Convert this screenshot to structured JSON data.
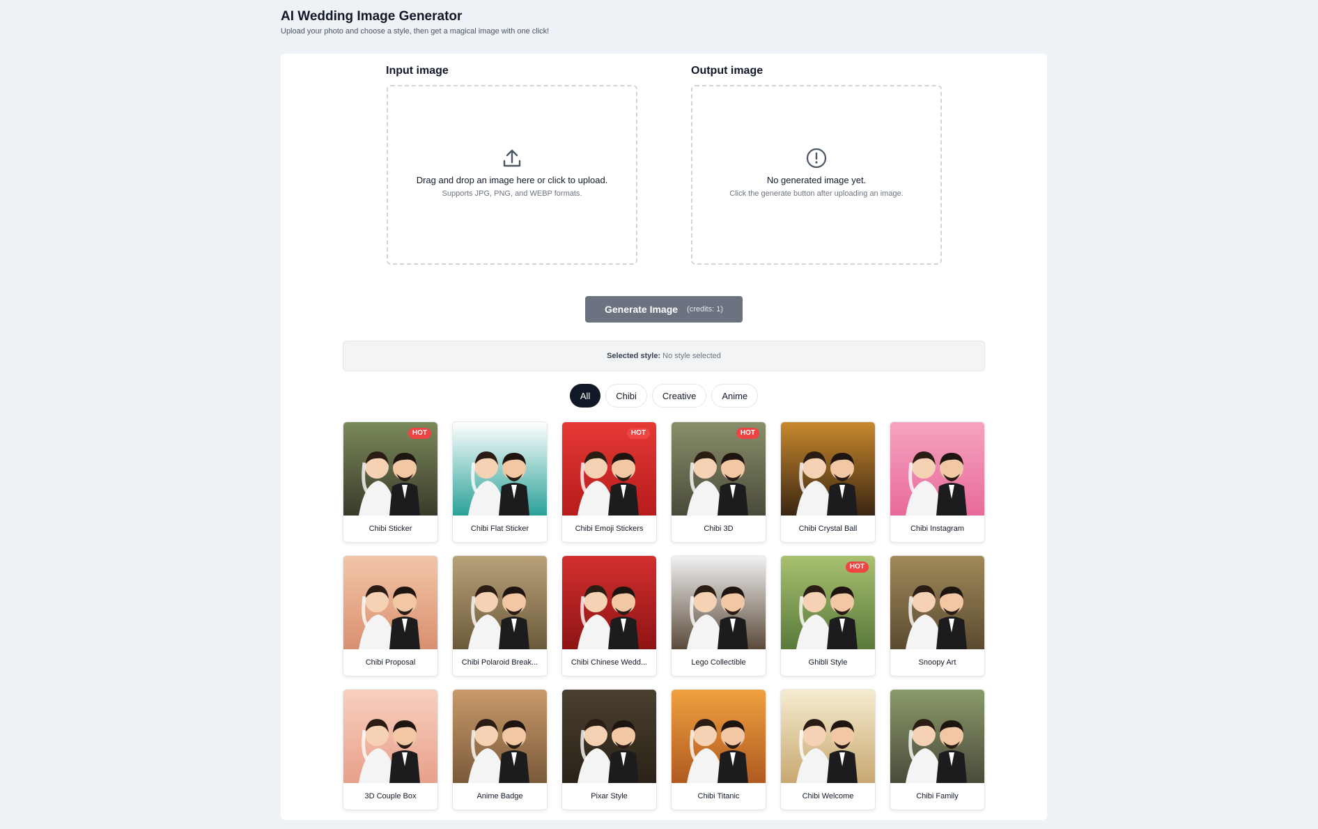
{
  "header": {
    "title": "AI Wedding Image Generator",
    "subtitle": "Upload your photo and choose a style, then get a magical image with one click!"
  },
  "input": {
    "label": "Input image",
    "main_text": "Drag and drop an image here or click to upload.",
    "sub_text": "Supports JPG, PNG, and WEBP formats.",
    "icon": "upload-icon"
  },
  "output": {
    "label": "Output image",
    "main_text": "No generated image yet.",
    "sub_text": "Click the generate button after uploading an image.",
    "icon": "alert-circle-icon"
  },
  "generate": {
    "label": "Generate Image",
    "credits": "(credits: 1)"
  },
  "selected_style": {
    "label": "Selected style:",
    "value": "No style selected"
  },
  "filters": [
    {
      "label": "All",
      "active": true
    },
    {
      "label": "Chibi",
      "active": false
    },
    {
      "label": "Creative",
      "active": false
    },
    {
      "label": "Anime",
      "active": false
    }
  ],
  "hot_badge": "HOT",
  "colors": {
    "accent_dark": "#111827",
    "hot": "#ef4444",
    "button_disabled": "#6b7280",
    "page_bg": "#eef1f5"
  },
  "styles": [
    {
      "name": "Chibi Sticker",
      "hot": true,
      "bg1": "#7a8a5a",
      "bg2": "#3a3a2a"
    },
    {
      "name": "Chibi Flat Sticker",
      "hot": false,
      "bg1": "#ffffff",
      "bg2": "#2aa198"
    },
    {
      "name": "Chibi Emoji Stickers",
      "hot": true,
      "bg1": "#e53935",
      "bg2": "#b71c1c"
    },
    {
      "name": "Chibi 3D",
      "hot": true,
      "bg1": "#8a8f6a",
      "bg2": "#4a4a3a"
    },
    {
      "name": "Chibi Crystal Ball",
      "hot": false,
      "bg1": "#c8892d",
      "bg2": "#3b2612"
    },
    {
      "name": "Chibi Instagram",
      "hot": false,
      "bg1": "#f5a3c0",
      "bg2": "#e86a9a"
    },
    {
      "name": "Chibi Proposal",
      "hot": false,
      "bg1": "#f2c6a8",
      "bg2": "#d99070"
    },
    {
      "name": "Chibi Polaroid Break...",
      "hot": false,
      "bg1": "#b9a27a",
      "bg2": "#6b5a3a"
    },
    {
      "name": "Chibi Chinese Wedd...",
      "hot": false,
      "bg1": "#d32f2f",
      "bg2": "#8e1414"
    },
    {
      "name": "Lego Collectible",
      "hot": false,
      "bg1": "#f2f2f2",
      "bg2": "#5a4a3a"
    },
    {
      "name": "Ghibli Style",
      "hot": true,
      "bg1": "#a8c070",
      "bg2": "#5a7a3a"
    },
    {
      "name": "Snoopy Art",
      "hot": false,
      "bg1": "#a08a5a",
      "bg2": "#5a4a30"
    },
    {
      "name": "3D Couple Box",
      "hot": false,
      "bg1": "#f8d0c0",
      "bg2": "#e8a08a"
    },
    {
      "name": "Anime Badge",
      "hot": false,
      "bg1": "#c89a6a",
      "bg2": "#7a5a3a"
    },
    {
      "name": "Pixar Style",
      "hot": false,
      "bg1": "#4a4030",
      "bg2": "#2a2218"
    },
    {
      "name": "Chibi Titanic",
      "hot": false,
      "bg1": "#f0a040",
      "bg2": "#b05a20"
    },
    {
      "name": "Chibi Welcome",
      "hot": false,
      "bg1": "#f5ecd0",
      "bg2": "#c8a870"
    },
    {
      "name": "Chibi Family",
      "hot": false,
      "bg1": "#8a9a6a",
      "bg2": "#4a4a3a"
    }
  ]
}
